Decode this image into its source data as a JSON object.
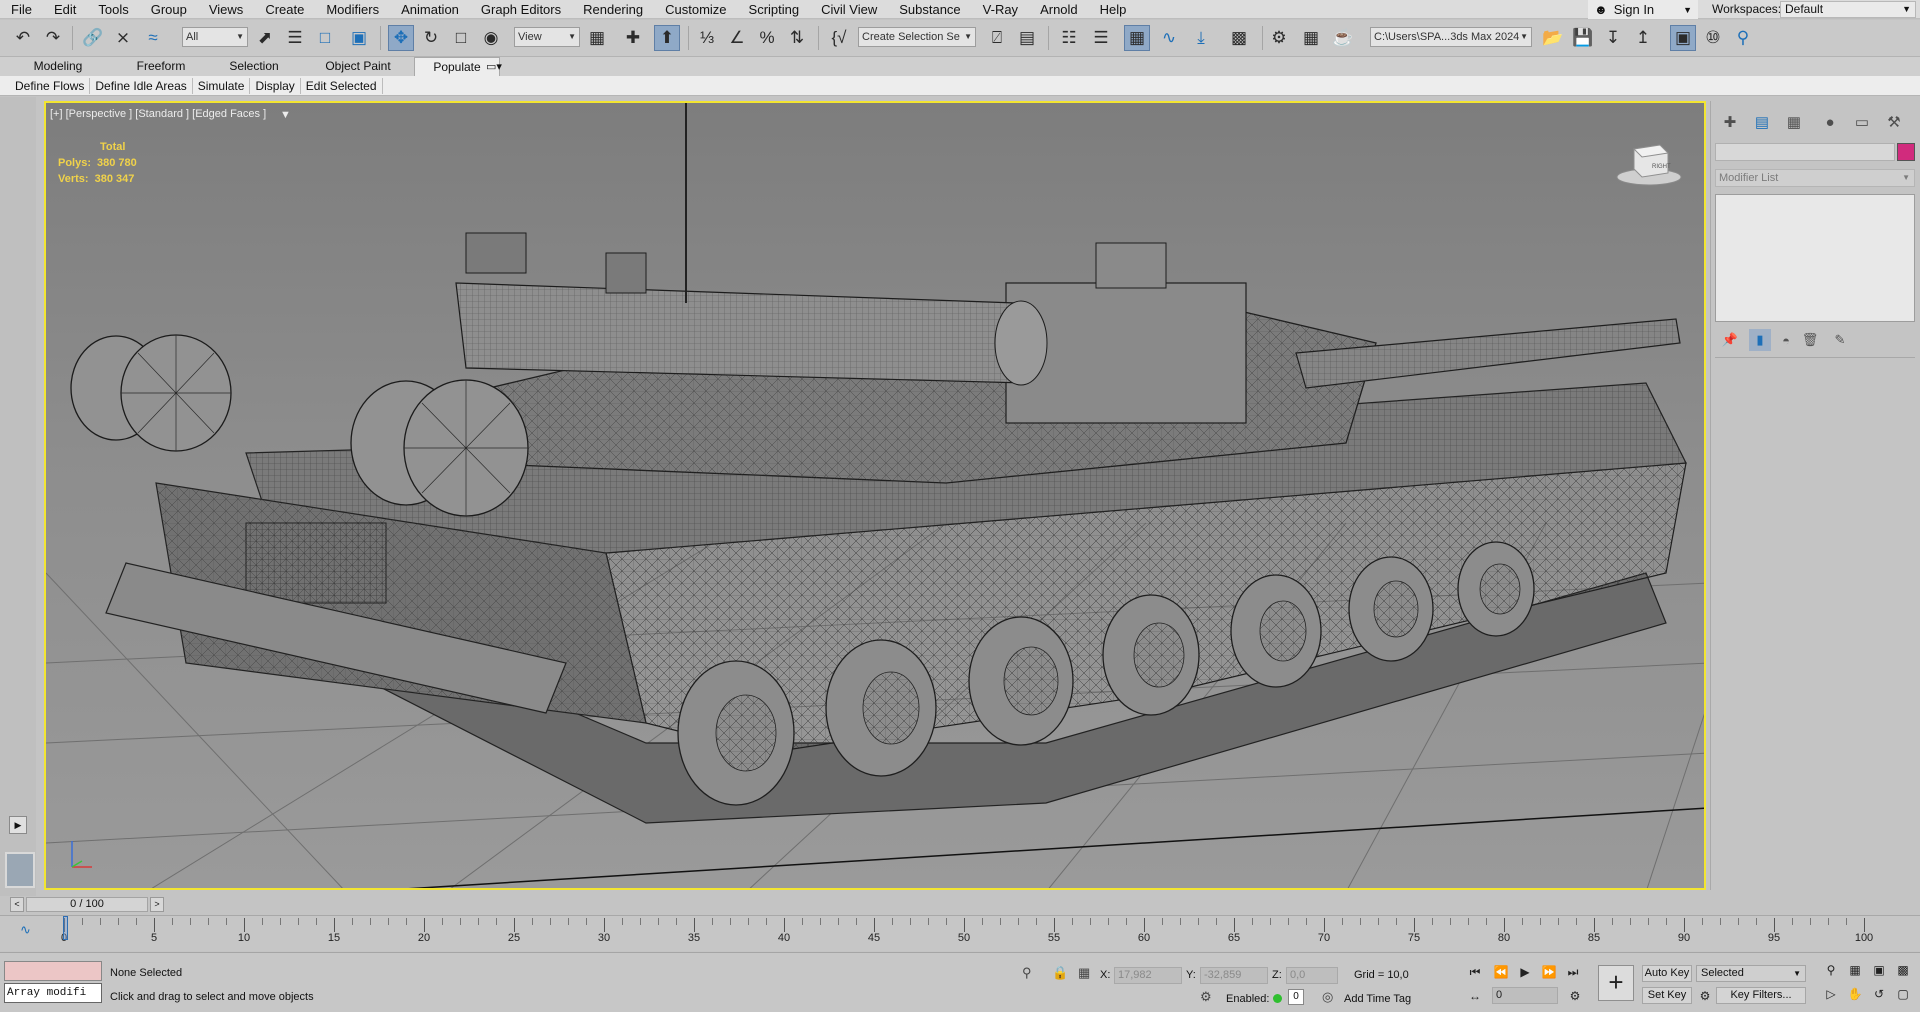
{
  "menu": [
    "File",
    "Edit",
    "Tools",
    "Group",
    "Views",
    "Create",
    "Modifiers",
    "Animation",
    "Graph Editors",
    "Rendering",
    "Customize",
    "Scripting",
    "Civil View",
    "Substance",
    "V-Ray",
    "Arnold",
    "Help"
  ],
  "account": {
    "sign_in": "Sign In",
    "workspaces_label": "Workspaces:",
    "workspace": "Default"
  },
  "toolbar": {
    "selection_filter": "All",
    "ref_coord": "View",
    "named_selection": "Create Selection Se",
    "project_path": "C:\\Users\\SPA...3ds Max 2024"
  },
  "ribbon": {
    "tabs": [
      "Modeling",
      "Freeform",
      "Selection",
      "Object Paint",
      "Populate"
    ],
    "active_tab": "Populate",
    "sub_buttons": [
      "Define Flows",
      "Define Idle Areas",
      "Simulate",
      "Display",
      "Edit Selected"
    ]
  },
  "viewport": {
    "label": "[+] [Perspective ] [Standard ] [Edged Faces ]",
    "stats": {
      "total_label": "Total",
      "polys_label": "Polys:",
      "polys": "380 780",
      "verts_label": "Verts:",
      "verts": "380 347"
    },
    "viewcube_face": "RIGHT",
    "border_color": "#f2e531"
  },
  "command_panel": {
    "modifier_list": "Modifier List",
    "object_color": "#d12b7d"
  },
  "timeline": {
    "frame": "0 / 100",
    "start": 0,
    "end": 100,
    "ticks": [
      0,
      5,
      10,
      15,
      20,
      25,
      30,
      35,
      40,
      45,
      50,
      55,
      60,
      65,
      70,
      75,
      80,
      85,
      90,
      95,
      100
    ]
  },
  "status": {
    "maxscript": "Array modifi",
    "selection": "None Selected",
    "prompt": "Click and drag to select and move objects",
    "x_label": "X:",
    "x": "17,982",
    "y_label": "Y:",
    "y": "-32,859",
    "z_label": "Z:",
    "z": "0,0",
    "grid": "Grid = 10,0",
    "enabled_label": "Enabled:",
    "enabled_value": "0",
    "add_time_tag": "Add Time Tag",
    "auto_key": "Auto Key",
    "set_key": "Set Key",
    "key_mode": "Selected",
    "frame_field": "0",
    "key_filters": "Key Filters..."
  }
}
